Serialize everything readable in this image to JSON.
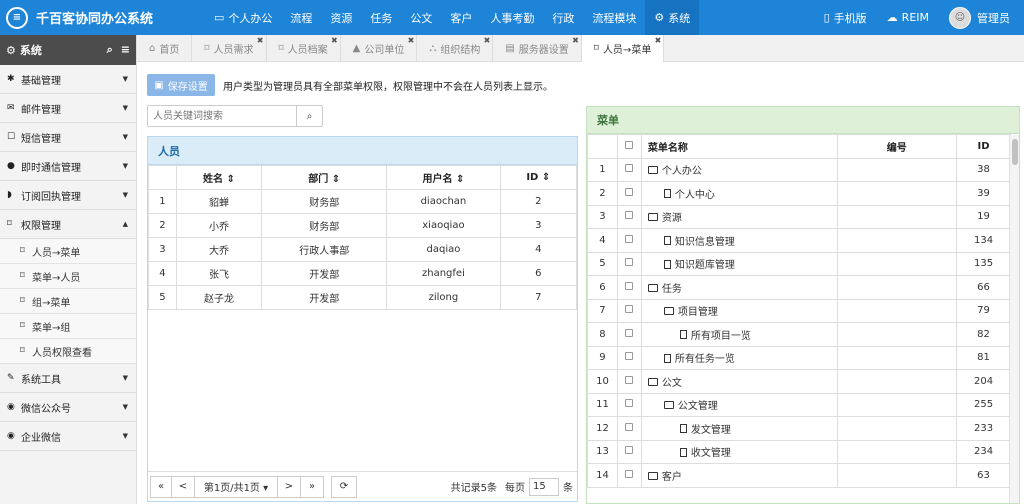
{
  "app": {
    "title": "千百客协同办公系统"
  },
  "topnav": [
    {
      "icon": "monitor-icon",
      "glyph": "▭",
      "label": "个人办公"
    },
    {
      "icon": "",
      "glyph": "",
      "label": "流程"
    },
    {
      "icon": "",
      "glyph": "",
      "label": "资源"
    },
    {
      "icon": "",
      "glyph": "",
      "label": "任务"
    },
    {
      "icon": "",
      "glyph": "",
      "label": "公文"
    },
    {
      "icon": "",
      "glyph": "",
      "label": "客户"
    },
    {
      "icon": "",
      "glyph": "",
      "label": "人事考勤"
    },
    {
      "icon": "",
      "glyph": "",
      "label": "行政"
    },
    {
      "icon": "",
      "glyph": "",
      "label": "流程模块"
    },
    {
      "icon": "gear-icon",
      "glyph": "⚙",
      "label": "系统",
      "active": true
    }
  ],
  "topright": {
    "mobile": "手机版",
    "reim": "REIM",
    "user": "管理员"
  },
  "sidebar": {
    "title": "系统",
    "items": [
      {
        "label": "基础管理",
        "glyph": "✱",
        "icon": "asterisk-icon",
        "caret": "▼"
      },
      {
        "label": "邮件管理",
        "glyph": "✉",
        "icon": "mail-icon",
        "caret": "▼"
      },
      {
        "label": "短信管理",
        "glyph": "☐",
        "icon": "sms-icon",
        "caret": "▼"
      },
      {
        "label": "即时通信管理",
        "glyph": "●",
        "icon": "chat-icon",
        "caret": "▼"
      },
      {
        "label": "订阅回执管理",
        "glyph": "◗",
        "icon": "rss-icon",
        "caret": "▼"
      },
      {
        "label": "权限管理",
        "glyph": "⌑",
        "icon": "bookmark-icon",
        "caret": "▲"
      }
    ],
    "subitems": [
      {
        "label": "人员→菜单"
      },
      {
        "label": "菜单→人员"
      },
      {
        "label": "组→菜单"
      },
      {
        "label": "菜单→组"
      },
      {
        "label": "人员权限查看"
      }
    ],
    "items2": [
      {
        "label": "系统工具",
        "glyph": "✎",
        "icon": "wrench-icon",
        "caret": "▼"
      },
      {
        "label": "微信公众号",
        "glyph": "◉",
        "icon": "wechat-icon",
        "caret": "▼"
      },
      {
        "label": "企业微信",
        "glyph": "◉",
        "icon": "wechat-work-icon",
        "caret": "▼"
      }
    ]
  },
  "tabs": [
    {
      "label": "首页",
      "glyph": "⌂",
      "icon": "home-icon"
    },
    {
      "label": "人员需求",
      "glyph": "⌑",
      "icon": "bookmark-icon"
    },
    {
      "label": "人员档案",
      "glyph": "⌑",
      "icon": "bookmark-icon"
    },
    {
      "label": "公司单位",
      "glyph": "▲",
      "icon": "building-icon"
    },
    {
      "label": "组织结构",
      "glyph": "⛬",
      "icon": "sitemap-icon"
    },
    {
      "label": "服务器设置",
      "glyph": "▤",
      "icon": "server-icon"
    },
    {
      "label": "人员→菜单",
      "glyph": "⌑",
      "icon": "bookmark-icon",
      "active": true
    }
  ],
  "main": {
    "save_label": "保存设置",
    "note": "用户类型为管理员具有全部菜单权限，权限管理中不会在人员列表上显示。",
    "search_placeholder": "人员关键词搜索",
    "people": {
      "title": "人员",
      "headers": [
        "",
        "姓名 ⇕",
        "部门 ⇕",
        "用户名 ⇕",
        "ID ⇕"
      ],
      "rows": [
        [
          "1",
          "貂蝉",
          "财务部",
          "diaochan",
          "2"
        ],
        [
          "2",
          "小乔",
          "财务部",
          "xiaoqiao",
          "3"
        ],
        [
          "3",
          "大乔",
          "行政人事部",
          "daqiao",
          "4"
        ],
        [
          "4",
          "张飞",
          "开发部",
          "zhangfei",
          "6"
        ],
        [
          "5",
          "赵子龙",
          "开发部",
          "zilong",
          "7"
        ]
      ]
    },
    "pager": {
      "first": "«",
      "prev": "<",
      "page": "第1页/共1页 ▾",
      "next": ">",
      "last": "»",
      "refresh": "⟳",
      "total": "共记录5条",
      "per_label": "每页",
      "per": "15",
      "unit": "条"
    },
    "menu": {
      "title": "菜单",
      "headers": [
        "",
        "",
        "菜单名称",
        "编号",
        "ID"
      ],
      "rows": [
        {
          "n": "1",
          "name": "个人办公",
          "type": "folder",
          "indent": 0,
          "code": "",
          "id": "38"
        },
        {
          "n": "2",
          "name": "个人中心",
          "type": "file",
          "indent": 1,
          "code": "",
          "id": "39"
        },
        {
          "n": "3",
          "name": "资源",
          "type": "folder",
          "indent": 0,
          "code": "",
          "id": "19"
        },
        {
          "n": "4",
          "name": "知识信息管理",
          "type": "file",
          "indent": 1,
          "code": "",
          "id": "134"
        },
        {
          "n": "5",
          "name": "知识题库管理",
          "type": "file",
          "indent": 1,
          "code": "",
          "id": "135"
        },
        {
          "n": "6",
          "name": "任务",
          "type": "folder",
          "indent": 0,
          "code": "",
          "id": "66"
        },
        {
          "n": "7",
          "name": "项目管理",
          "type": "folder",
          "indent": 1,
          "code": "",
          "id": "79"
        },
        {
          "n": "8",
          "name": "所有项目一览",
          "type": "file",
          "indent": 2,
          "code": "",
          "id": "82"
        },
        {
          "n": "9",
          "name": "所有任务一览",
          "type": "file",
          "indent": 1,
          "code": "",
          "id": "81"
        },
        {
          "n": "10",
          "name": "公文",
          "type": "folder",
          "indent": 0,
          "code": "",
          "id": "204"
        },
        {
          "n": "11",
          "name": "公文管理",
          "type": "folder",
          "indent": 1,
          "code": "",
          "id": "255"
        },
        {
          "n": "12",
          "name": "发文管理",
          "type": "file",
          "indent": 2,
          "code": "",
          "id": "233"
        },
        {
          "n": "13",
          "name": "收文管理",
          "type": "file",
          "indent": 2,
          "code": "",
          "id": "234"
        },
        {
          "n": "14",
          "name": "客户",
          "type": "folder",
          "indent": 0,
          "code": "",
          "id": "63"
        }
      ]
    }
  }
}
